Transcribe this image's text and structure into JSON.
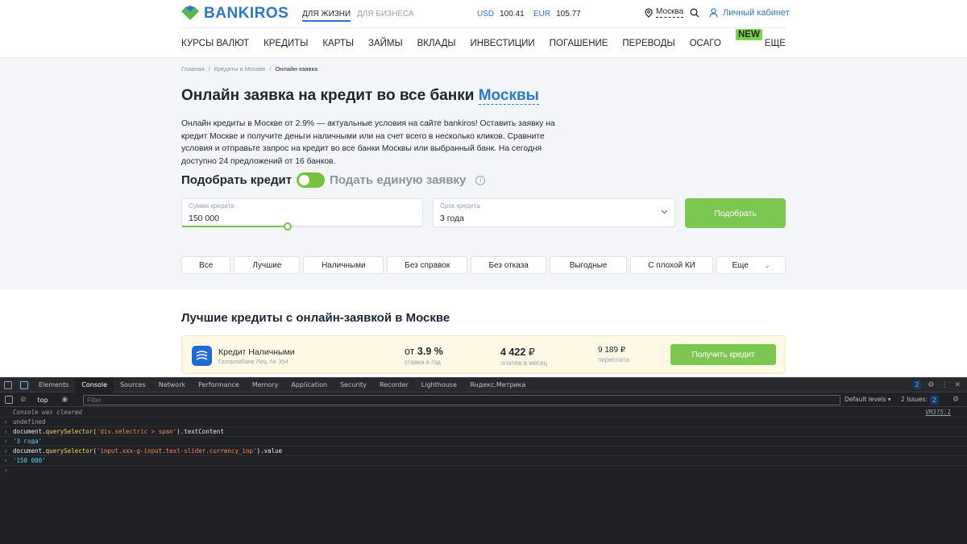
{
  "header": {
    "logo_text": "BANKIROS",
    "segment_life": "ДЛЯ ЖИЗНИ",
    "segment_business": "ДЛЯ БИЗНЕСА",
    "rates": [
      {
        "currency": "USD",
        "value": "100.41"
      },
      {
        "currency": "EUR",
        "value": "105.77"
      }
    ],
    "city": "Москва",
    "cabinet_label": "Личный кабинет",
    "nav": [
      "КУРСЫ ВАЛЮТ",
      "КРЕДИТЫ",
      "КАРТЫ",
      "ЗАЙМЫ",
      "ВКЛАДЫ",
      "ИНВЕСТИЦИИ",
      "ПОГАШЕНИЕ",
      "ПЕРЕВОДЫ",
      "ОСАГО",
      "ЕЩЕ"
    ],
    "new_badge": "NEW"
  },
  "breadcrumb": [
    "Главная",
    "Кредиты в Москве",
    "Онлайн-заявка"
  ],
  "hero": {
    "title": "Онлайн заявка на кредит во все банки",
    "title_city": "Москвы",
    "intro": "Онлайн кредиты в Москве от 2.9% — актуальные условия на сайте bankiros! Оставить заявку на кредит Москве и получите деньги наличными или на счет всего в несколько кликов. Сравните условия и отправьте запрос на кредит во все банки Москвы или выбранный банк. На сегодня доступно 24 предложений от 16 банков.",
    "toggle_on_label": "Подобрать кредит",
    "toggle_off_label": "Подать единую заявку",
    "info_glyph": "i",
    "toggle_state": "on"
  },
  "form": {
    "amount_label": "Сумма кредита",
    "amount_value": "150 000",
    "amount_slider_fraction": 0.44,
    "term_label": "Срок кредита",
    "term_value": "3 года",
    "submit_label": "Подобрать"
  },
  "chips": [
    "Все",
    "Лучшие",
    "Наличными",
    "Без справок",
    "Без отказа",
    "Выгодные",
    "С плохой КИ",
    "Еще"
  ],
  "best": {
    "section_title": "Лучшие кредиты с онлайн-заявкой в Москве",
    "card": {
      "product": "Кредит Наличными",
      "bank_license": "Газпромбанк Лиц. № 354",
      "rate_prefix": "от",
      "rate_value": "3.9 %",
      "rate_caption": "ставка в год",
      "payment_value": "4 422",
      "payment_currency": "₽",
      "payment_caption": "платеж в месяц",
      "overpay_value": "9 189 ₽",
      "overpay_caption": "переплата",
      "cta": "Получить кредит"
    }
  },
  "devtools": {
    "tabs": [
      "Elements",
      "Console",
      "Sources",
      "Network",
      "Performance",
      "Memory",
      "Application",
      "Security",
      "Recorder",
      "Lighthouse",
      "Яндекс.Метрика"
    ],
    "active_tab": "Console",
    "badge_count": "2",
    "context": "top",
    "filter_placeholder": "Filter",
    "levels": "Default levels ▾",
    "issues_label": "2 Issues:",
    "issues_count": "2",
    "console": {
      "cleared": "Console was cleared",
      "cleared_source": "VM375:1",
      "undefined": "undefined",
      "cmd1_prefix": "document.",
      "cmd1_fn": "querySelector",
      "cmd1_open": "(",
      "cmd1_arg": "'div.selectric > span'",
      "cmd1_rest": ").textContent",
      "res1": "'3 года'",
      "cmd2_prefix": "document.",
      "cmd2_fn": "querySelector",
      "cmd2_open": "(",
      "cmd2_arg": "'input.xxx-g-input.text-slider.currency_inp'",
      "cmd2_rest": ").value",
      "res2": "'150 000'",
      "prompt_mark": "›",
      "return_mark": "‹"
    }
  },
  "colors": {
    "brand_blue": "#2b78d3",
    "accent_green": "#7cc652",
    "hero_bg": "#f3f5f8",
    "card_bg": "#fdf9e5",
    "devtools_bg": "#202124"
  }
}
